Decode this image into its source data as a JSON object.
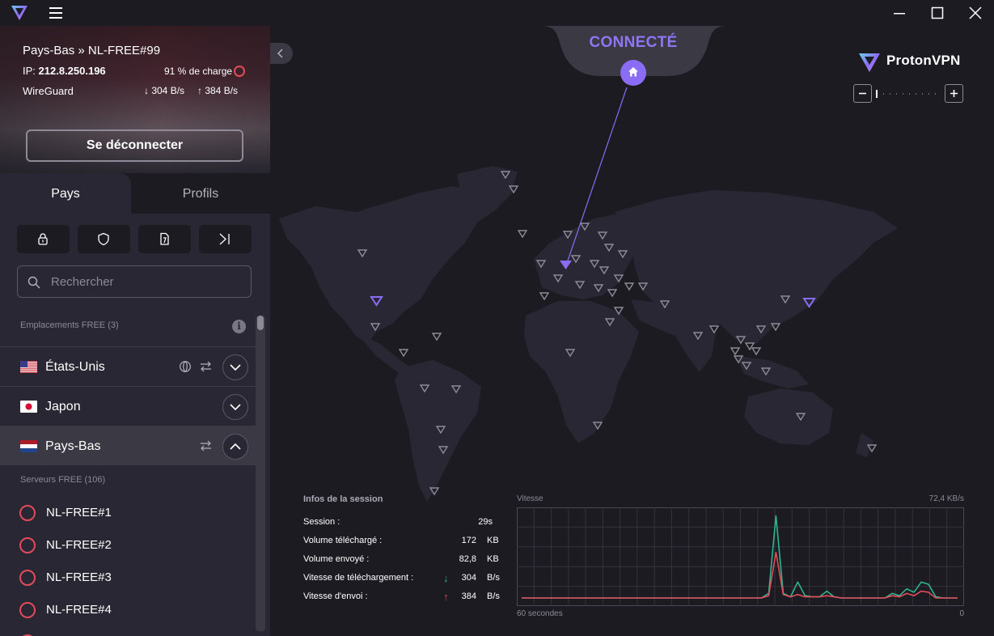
{
  "window": {
    "menu_icon": "hamburger-icon",
    "controls": [
      "minimize-icon",
      "maximize-icon",
      "close-icon"
    ]
  },
  "connection": {
    "server": "Pays-Bas » NL-FREE#99",
    "ip_label": "IP:",
    "ip": "212.8.250.196",
    "load": "91 % de charge",
    "protocol": "WireGuard",
    "download_rate": "↓ 304 B/s",
    "upload_rate": "↑ 384 B/s",
    "disconnect_label": "Se déconnecter"
  },
  "tabs": {
    "countries": "Pays",
    "profiles": "Profils"
  },
  "filters": [
    "lock-icon",
    "shield-icon",
    "sim-card-icon",
    "arrow-right-to-bar-icon"
  ],
  "search": {
    "placeholder": "Rechercher"
  },
  "free_locations": {
    "label": "Emplacements FREE (3)",
    "countries": [
      {
        "name": "États-Unis",
        "expanded": false
      },
      {
        "name": "Japon",
        "expanded": false
      },
      {
        "name": "Pays-Bas",
        "expanded": true
      }
    ]
  },
  "free_servers": {
    "label": "Serveurs FREE (106)",
    "servers": [
      "NL-FREE#1",
      "NL-FREE#2",
      "NL-FREE#3",
      "NL-FREE#4"
    ]
  },
  "map": {
    "status": "CONNECTÉ",
    "brand_primary": "Proton",
    "brand_secondary": "VPN",
    "accent_color": "#8a6cf6"
  },
  "session": {
    "title": "Infos de la session",
    "rows": [
      {
        "label": "Session :",
        "value": "29s",
        "unit": ""
      },
      {
        "label": "Volume téléchargé :",
        "value": "172",
        "unit": "KB"
      },
      {
        "label": "Volume envoyé :",
        "value": "82,8",
        "unit": "KB"
      },
      {
        "label": "Vitesse de téléchargement :",
        "value": "304",
        "unit": "B/s"
      },
      {
        "label": "Vitesse d'envoi :",
        "value": "384",
        "unit": "B/s"
      }
    ]
  },
  "speed_chart": {
    "label": "Vitesse",
    "max_label": "72,4  KB/s",
    "x_start_label": "60 secondes",
    "x_end_label": "0",
    "download_color": "#2fb48f",
    "upload_color": "#e24b58"
  },
  "chart_data": {
    "type": "line",
    "title": "Vitesse",
    "xlabel": "",
    "ylabel": "",
    "x": [
      60,
      57,
      54,
      51,
      48,
      45,
      42,
      39,
      36,
      33,
      30,
      27,
      26,
      25,
      24,
      23,
      22,
      21,
      20,
      19,
      18,
      17,
      16,
      15,
      14,
      13,
      12,
      11,
      10,
      9,
      8,
      7,
      6,
      5,
      4,
      3,
      2,
      1,
      0
    ],
    "ylim": [
      0,
      72.4
    ],
    "grid": true,
    "series": [
      {
        "values": [
          0,
          0,
          0,
          0,
          0,
          0,
          0,
          0,
          0,
          0,
          0,
          0,
          4,
          72,
          4,
          1,
          14,
          2,
          1,
          1,
          6,
          1,
          0,
          0,
          0,
          0,
          0,
          0,
          0,
          4,
          2,
          8,
          5,
          14,
          12,
          1,
          0,
          0,
          0
        ]
      },
      {
        "values": [
          0,
          0,
          0,
          0,
          0,
          0,
          0,
          0,
          0,
          0,
          0,
          0,
          2,
          40,
          3,
          1,
          3,
          1,
          1,
          1,
          2,
          1,
          0,
          0,
          0,
          0,
          0,
          0,
          0,
          2,
          1,
          4,
          2,
          6,
          5,
          0,
          0,
          0,
          0
        ]
      }
    ]
  }
}
